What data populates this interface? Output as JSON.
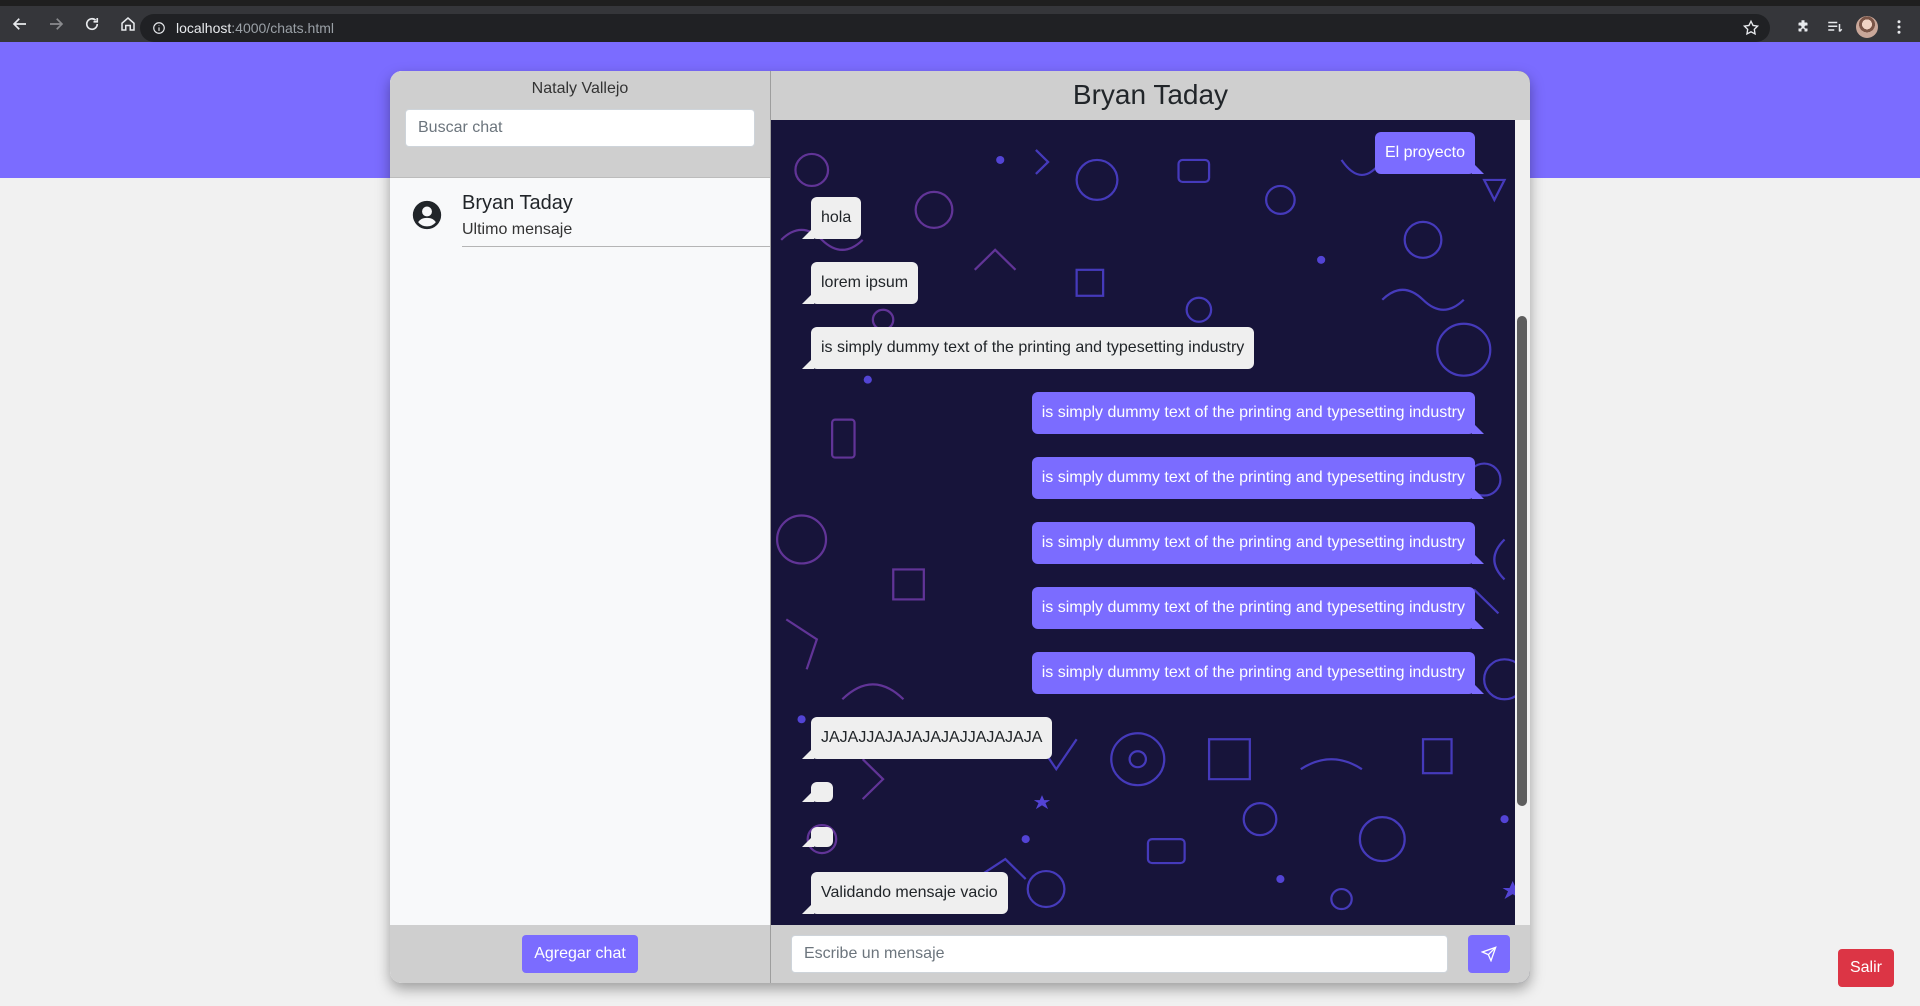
{
  "browser": {
    "url_host": "localhost",
    "url_path": ":4000/chats.html",
    "icons": [
      "back-icon",
      "forward-icon",
      "reload-icon",
      "home-icon",
      "info-icon",
      "star-icon",
      "extensions-icon",
      "reading-list-icon",
      "profile-avatar",
      "menu-icon"
    ]
  },
  "sidebar": {
    "user_name": "Nataly Vallejo",
    "search_placeholder": "Buscar chat",
    "chats": [
      {
        "name": "Bryan Taday",
        "last_message": "Ultimo mensaje"
      }
    ],
    "add_chat_label": "Agregar chat"
  },
  "conversation": {
    "title": "Bryan Taday",
    "messages": [
      {
        "direction": "out",
        "text": "El proyecto"
      },
      {
        "direction": "in",
        "text": "hola"
      },
      {
        "direction": "in",
        "text": "lorem ipsum"
      },
      {
        "direction": "in",
        "text": "is simply dummy text of the printing and typesetting industry"
      },
      {
        "direction": "out",
        "text": "is simply dummy text of the printing and typesetting industry"
      },
      {
        "direction": "out",
        "text": "is simply dummy text of the printing and typesetting industry"
      },
      {
        "direction": "out",
        "text": "is simply dummy text of the printing and typesetting industry"
      },
      {
        "direction": "out",
        "text": "is simply dummy text of the printing and typesetting industry"
      },
      {
        "direction": "out",
        "text": "is simply dummy text of the printing and typesetting industry"
      },
      {
        "direction": "in",
        "text": "JAJAJJAJAJAJAJAJJAJAJAJA"
      },
      {
        "direction": "in",
        "text": ""
      },
      {
        "direction": "in",
        "text": ""
      },
      {
        "direction": "in",
        "text": "Validando mensaje vacio"
      }
    ],
    "input_placeholder": "Escribe un mensaje"
  },
  "logout_label": "Salir",
  "colors": {
    "accent": "#7b6cff",
    "danger": "#dc3545",
    "panel_gray": "#cfcfcf",
    "incoming_bubble": "#efefef"
  }
}
